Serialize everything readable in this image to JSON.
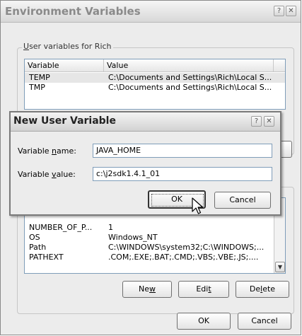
{
  "env_window": {
    "title": "Environment Variables",
    "help_glyph": "?",
    "close_glyph": "✕",
    "user_group_label": "User variables for Rich",
    "user_group_label_mnemonic": "U",
    "user_group_label_rest": "ser variables for Rich",
    "columns": [
      "Variable",
      "Value"
    ],
    "user_rows": [
      {
        "variable": "TEMP",
        "value": "C:\\Documents and Settings\\Rich\\Local S..."
      },
      {
        "variable": "TMP",
        "value": "C:\\Documents and Settings\\Rich\\Local S..."
      }
    ],
    "system_rows": [
      {
        "variable": "NUMBER_OF_P...",
        "value": "1"
      },
      {
        "variable": "OS",
        "value": "Windows_NT"
      },
      {
        "variable": "Path",
        "value": "C:\\WINDOWS\\system32;C:\\WINDOWS;..."
      },
      {
        "variable": "PATHEXT",
        "value": ".COM;.EXE;.BAT;.CMD;.VBS;.VBE;.JS;...."
      }
    ],
    "buttons": {
      "new": {
        "pre": "Ne",
        "key": "w",
        "post": ""
      },
      "edit": {
        "pre": "Edi",
        "key": "t",
        "post": ""
      },
      "delete": {
        "pre": "De",
        "key": "l",
        "post": "ete"
      },
      "ok": "OK",
      "cancel": "Cancel"
    }
  },
  "dialog": {
    "title": "New User Variable",
    "help_glyph": "?",
    "close_glyph": "✕",
    "name_label": {
      "pre": "Variable ",
      "key": "n",
      "post": "ame:"
    },
    "value_label": {
      "pre": "Variable ",
      "key": "v",
      "post": "alue:"
    },
    "name_value": "JAVA_HOME",
    "value_value": "c:\\j2sdk1.4.1_01",
    "ok_label": "OK",
    "cancel_label": "Cancel"
  }
}
